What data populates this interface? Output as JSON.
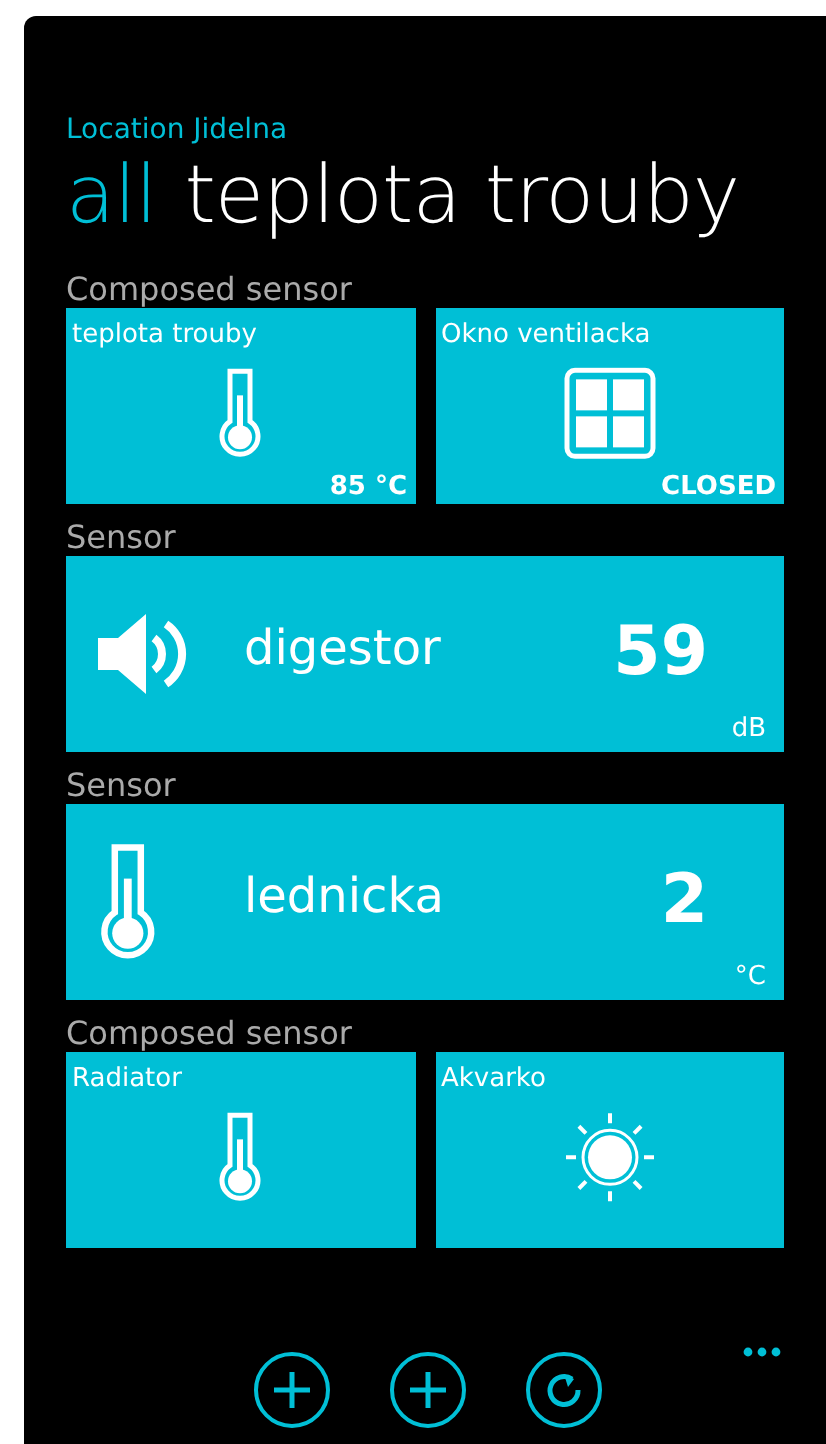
{
  "location": "Location Jidelna",
  "pivot": [
    {
      "label": "all",
      "selected": true
    },
    {
      "label": "teplota trouby",
      "selected": false
    }
  ],
  "groups": [
    {
      "label": "Composed sensor",
      "kind": "pair",
      "tiles": [
        {
          "name": "teplota trouby",
          "kind": "thermometer",
          "value": "85 °C"
        },
        {
          "name": "Okno ventilacka",
          "kind": "window",
          "value": "CLOSED"
        }
      ]
    },
    {
      "label": "Sensor",
      "kind": "wide",
      "tiles": [
        {
          "name": "digestor",
          "kind": "speaker",
          "value": "59",
          "unit": "dB"
        }
      ]
    },
    {
      "label": "Sensor",
      "kind": "wide",
      "tiles": [
        {
          "name": "lednicka",
          "kind": "thermometer",
          "value": "2",
          "unit": "°C"
        }
      ]
    },
    {
      "label": "Composed sensor",
      "kind": "pair",
      "tiles": [
        {
          "name": "Radiator",
          "kind": "thermometer"
        },
        {
          "name": "Akvarko",
          "kind": "sun"
        }
      ]
    }
  ],
  "app_bar": [
    {
      "kind": "add"
    },
    {
      "kind": "add"
    },
    {
      "kind": "refresh"
    }
  ]
}
